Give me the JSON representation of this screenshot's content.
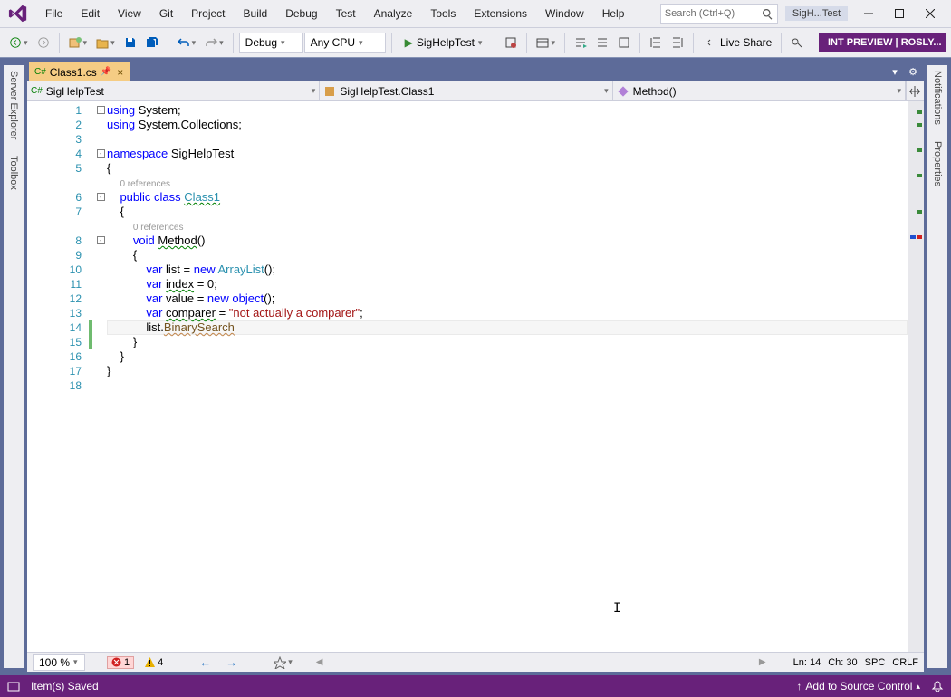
{
  "menus": [
    "File",
    "Edit",
    "View",
    "Git",
    "Project",
    "Build",
    "Debug",
    "Test",
    "Analyze",
    "Tools",
    "Extensions",
    "Window",
    "Help"
  ],
  "search_placeholder": "Search (Ctrl+Q)",
  "solution_name": "SigH...Test",
  "toolbar": {
    "config": "Debug",
    "platform": "Any CPU",
    "start_label": "SigHelpTest",
    "live_share": "Live Share",
    "preview_label": "INT PREVIEW | ROSLY..."
  },
  "left_tabs": [
    "Server Explorer",
    "Toolbox"
  ],
  "right_tabs": [
    "Notifications",
    "Properties"
  ],
  "file_tab": "Class1.cs",
  "nav": {
    "project": "SigHelpTest",
    "class": "SigHelpTest.Class1",
    "member": "Method()"
  },
  "code": {
    "lines": [
      {
        "n": 1,
        "fold": "box",
        "html": "<span class='kw'>using</span> System;"
      },
      {
        "n": 2,
        "html": "<span class='kw'>using</span> System.Collections;"
      },
      {
        "n": 3,
        "html": ""
      },
      {
        "n": 4,
        "fold": "box",
        "html": "<span class='kw'>namespace</span> SigHelpTest"
      },
      {
        "n": 5,
        "foldline": true,
        "html": "{"
      },
      {
        "n": null,
        "foldline": true,
        "html": "    <span class='codelens'>0 references</span>"
      },
      {
        "n": 6,
        "fold": "box",
        "html": "    <span class='kw'>public</span> <span class='kw'>class</span> <span class='type ident-squig'>Class1</span>"
      },
      {
        "n": 7,
        "foldline": true,
        "html": "    {"
      },
      {
        "n": null,
        "foldline": true,
        "html": "        <span class='codelens'>0 references</span>"
      },
      {
        "n": 8,
        "fold": "box",
        "html": "        <span class='kw'>void</span> <span class='ident-squig'>Method</span>()"
      },
      {
        "n": 9,
        "foldline": true,
        "html": "        {"
      },
      {
        "n": 10,
        "foldline": true,
        "html": "            <span class='kw'>var</span> list = <span class='kw'>new</span> <span class='type'>ArrayList</span>();"
      },
      {
        "n": 11,
        "foldline": true,
        "html": "            <span class='kw'>var</span> <span class='ident-squig'>index</span> = 0;"
      },
      {
        "n": 12,
        "foldline": true,
        "html": "            <span class='kw'>var</span> value = <span class='kw'>new</span> <span class='kw'>object</span>();"
      },
      {
        "n": 13,
        "foldline": true,
        "html": "            <span class='kw'>var</span> <span class='ident-squig'>comparer</span> = <span class='str'>\"not actually a comparer\"</span>;"
      },
      {
        "n": 14,
        "foldline": true,
        "change": "mod",
        "cur": true,
        "html": "            list.<span class='mem-squig'>BinarySearch</span>"
      },
      {
        "n": 15,
        "foldline": true,
        "change": "mod",
        "html": "        }"
      },
      {
        "n": 16,
        "foldline": true,
        "html": "    }"
      },
      {
        "n": 17,
        "html": "}"
      },
      {
        "n": 18,
        "html": ""
      }
    ]
  },
  "bottom": {
    "zoom": "100 %",
    "errors": "1",
    "warnings": "4",
    "ln_label": "Ln:",
    "ln": "14",
    "ch_label": "Ch:",
    "ch": "30",
    "indent": "SPC",
    "eol": "CRLF"
  },
  "status": {
    "msg": "Item(s) Saved",
    "source_control": "Add to Source Control"
  }
}
